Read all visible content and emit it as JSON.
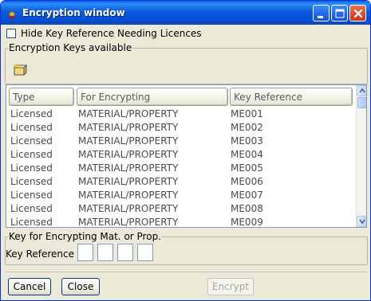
{
  "window": {
    "title": "Encryption window",
    "controls": [
      "minimize",
      "maximize",
      "close"
    ]
  },
  "options": {
    "hide_key_reference_label": "Hide Key Reference Needing Licences",
    "hide_key_reference_checked": false
  },
  "keys_group": {
    "legend": "Encryption Keys available",
    "toolbar_icon": "new-key-icon"
  },
  "table": {
    "columns": [
      "Type",
      "For Encrypting",
      "Key Reference"
    ],
    "rows": [
      [
        "Licensed",
        "MATERIAL/PROPERTY",
        "ME001"
      ],
      [
        "Licensed",
        "MATERIAL/PROPERTY",
        "ME002"
      ],
      [
        "Licensed",
        "MATERIAL/PROPERTY",
        "ME003"
      ],
      [
        "Licensed",
        "MATERIAL/PROPERTY",
        "ME004"
      ],
      [
        "Licensed",
        "MATERIAL/PROPERTY",
        "ME005"
      ],
      [
        "Licensed",
        "MATERIAL/PROPERTY",
        "ME006"
      ],
      [
        "Licensed",
        "MATERIAL/PROPERTY",
        "ME007"
      ],
      [
        "Licensed",
        "MATERIAL/PROPERTY",
        "ME008"
      ],
      [
        "Licensed",
        "MATERIAL/PROPERTY",
        "ME009"
      ]
    ]
  },
  "key_group": {
    "legend": "Key for Encrypting Mat. or Prop.",
    "key_reference_label": "Key Reference",
    "key_reference_values": [
      "",
      "",
      "",
      ""
    ]
  },
  "buttons": {
    "cancel": "Cancel",
    "close": "Close",
    "encrypt": "Encrypt"
  },
  "colors": {
    "titlebar": "#0550d6",
    "window_bg": "#ece9d8",
    "close_button": "#d9492a"
  }
}
